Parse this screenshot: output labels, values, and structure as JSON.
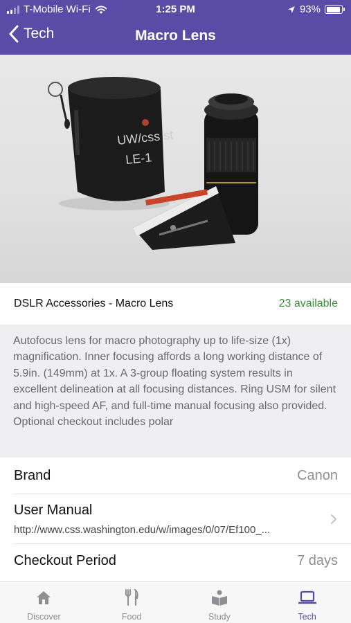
{
  "status_bar": {
    "carrier": "T-Mobile Wi-Fi",
    "time": "1:25 PM",
    "battery": "93%",
    "battery_level": 0.93
  },
  "nav": {
    "back_label": "Tech",
    "title": "Macro Lens"
  },
  "item": {
    "name": "DSLR Accessories - Macro Lens",
    "availability": "23 available",
    "description": "Autofocus lens for macro photography up to life-size (1x) magnification. Inner focusing affords a long working distance of 5.9in. (149mm) at 1x. A 3-group floating system results in excellent delineation at all focusing distances. Ring USM for silent and high-speed AF, and full-time manual focusing also provided. Optional checkout includes polar"
  },
  "details": {
    "brand_label": "Brand",
    "brand_value": "Canon",
    "manual_label": "User Manual",
    "manual_url": "http://www.css.washington.edu/w/images/0/07/Ef100_...",
    "checkout_label": "Checkout Period",
    "checkout_value": "7 days"
  },
  "tabs": [
    {
      "label": "Discover",
      "icon": "home-icon",
      "active": false
    },
    {
      "label": "Food",
      "icon": "fork-knife-icon",
      "active": false
    },
    {
      "label": "Study",
      "icon": "book-icon",
      "active": false
    },
    {
      "label": "Tech",
      "icon": "laptop-icon",
      "active": true
    }
  ],
  "colors": {
    "brand_purple": "#5a4ba6",
    "available_green": "#3c8f3c"
  }
}
